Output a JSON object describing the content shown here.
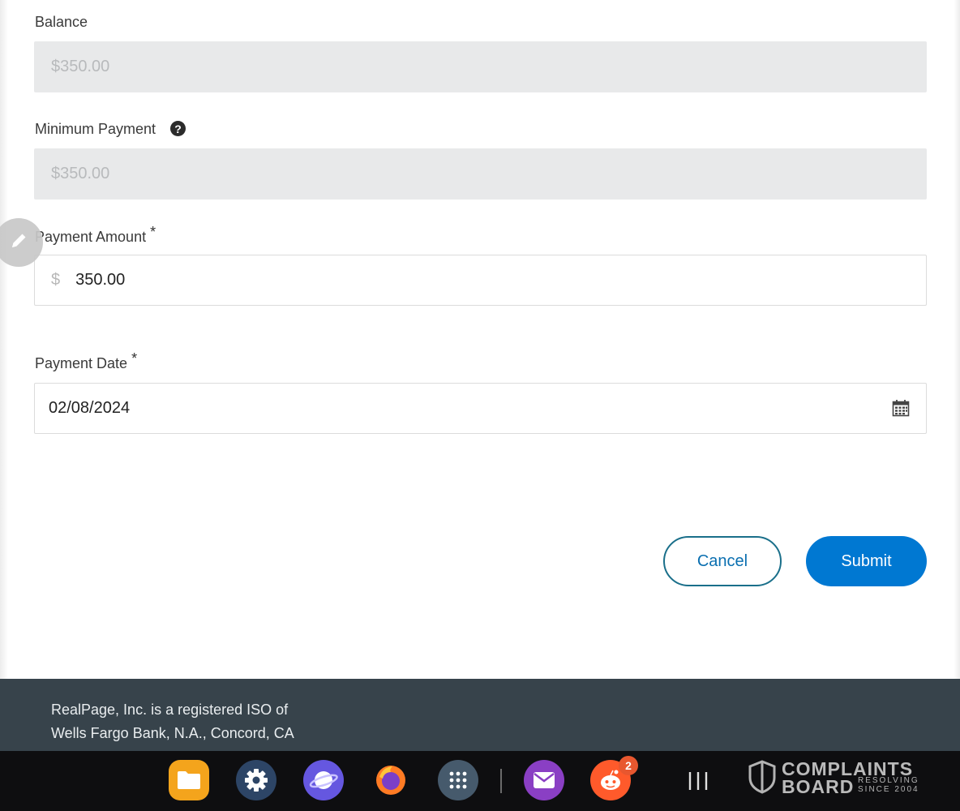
{
  "form": {
    "balance": {
      "label": "Balance",
      "value": "$350.00"
    },
    "minimum_payment": {
      "label": "Minimum Payment",
      "value": "$350.00"
    },
    "payment_amount": {
      "label": "Payment Amount",
      "required_mark": "*",
      "currency_symbol": "$",
      "value": "350.00"
    },
    "payment_date": {
      "label": "Payment Date",
      "required_mark": "*",
      "value": "02/08/2024"
    },
    "cancel_label": "Cancel",
    "submit_label": "Submit"
  },
  "footer": {
    "line1": "RealPage, Inc. is a registered ISO of",
    "line2": "Wells Fargo Bank, N.A., Concord, CA"
  },
  "taskbar": {
    "apps": [
      {
        "name": "files-icon",
        "color": "#f5a623"
      },
      {
        "name": "settings-icon",
        "color": "#3d5a80"
      },
      {
        "name": "internet-icon",
        "color": "#6c5ce7"
      },
      {
        "name": "firefox-icon",
        "color": "#ff7139"
      },
      {
        "name": "apps-grid-icon",
        "color": "#4a5d6e"
      },
      {
        "name": "email-icon",
        "color": "#8e44ad"
      },
      {
        "name": "reddit-icon",
        "color": "#ff5733"
      }
    ],
    "reddit_badge": "2"
  },
  "watermark": {
    "line1": "COMPLAINTS",
    "line2": "BOARD",
    "sub1": "RESOLVING",
    "sub2": "SINCE 2004"
  },
  "colors": {
    "primary": "#0078d2",
    "footer_bg": "#37434b",
    "disabled_bg": "#e8e9ea"
  }
}
